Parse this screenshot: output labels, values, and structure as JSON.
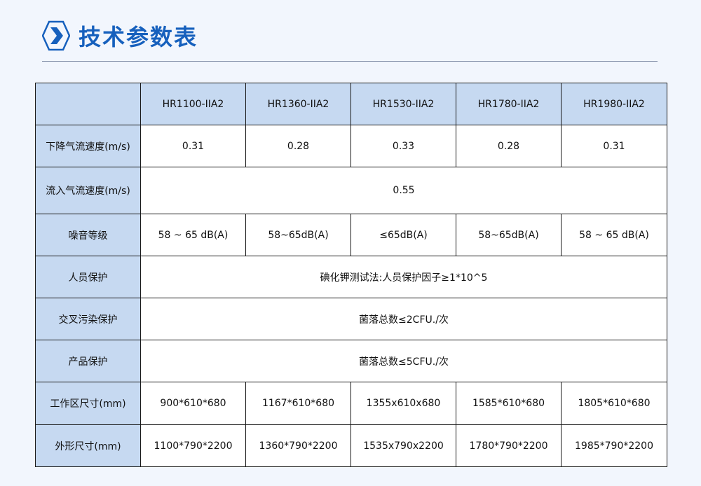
{
  "page": {
    "title": "技术参数表",
    "accent": "#1660bd",
    "header_bg": "#c6d9f1"
  },
  "table": {
    "models": [
      "HR1100-IIA2",
      "HR1360-IIA2",
      "HR1530-IIA2",
      "HR1780-IIA2",
      "HR1980-IIA2"
    ],
    "rows": [
      {
        "label": "下降气流速度(m/s)",
        "values": [
          "0.31",
          "0.28",
          "0.33",
          "0.28",
          "0.31"
        ]
      },
      {
        "label": "流入气流速度(m/s)",
        "merged": "0.55"
      },
      {
        "label": "噪音等级",
        "values": [
          "58 ~ 65 dB(A)",
          "58~65dB(A)",
          "≤65dB(A)",
          "58~65dB(A)",
          "58 ~ 65 dB(A)"
        ]
      },
      {
        "label": "人员保护",
        "merged": "碘化钾测试法:人员保护因子≥1*10^5"
      },
      {
        "label": "交叉污染保护",
        "merged": "菌落总数≤2CFU./次"
      },
      {
        "label": "产品保护",
        "merged": "菌落总数≤5CFU./次"
      },
      {
        "label": "工作区尺寸(mm)",
        "values": [
          "900*610*680",
          "1167*610*680",
          "1355x610x680",
          "1585*610*680",
          "1805*610*680"
        ]
      },
      {
        "label": "外形尺寸(mm)",
        "values": [
          "1100*790*2200",
          "1360*790*2200",
          "1535x790x2200",
          "1780*790*2200",
          "1985*790*2200"
        ]
      }
    ]
  }
}
